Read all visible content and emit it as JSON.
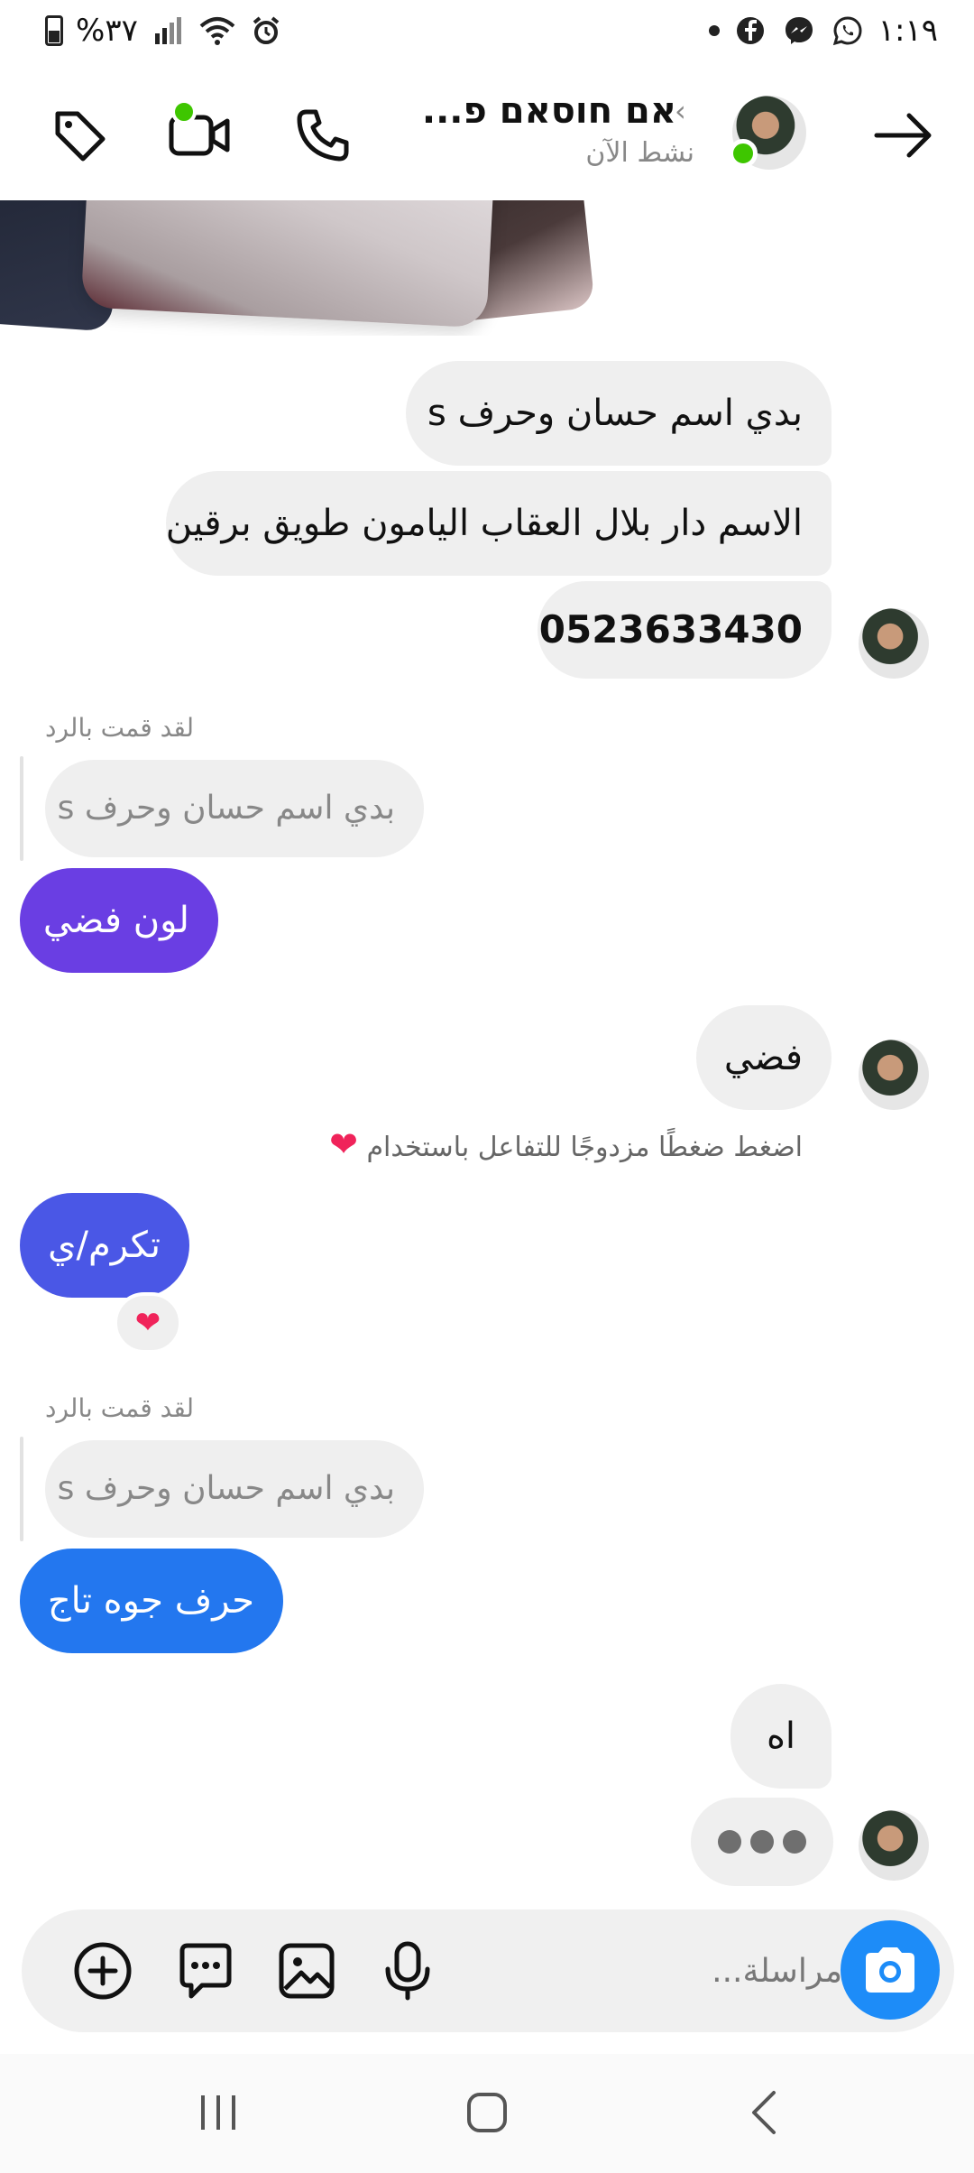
{
  "status_bar": {
    "time": "١:١٩",
    "battery": "%٣٧",
    "icons": [
      "whatsapp-icon",
      "messenger-icon",
      "facebook-icon",
      "notification-dot-icon",
      "alarm-icon",
      "wifi-icon",
      "signal-icon",
      "battery-icon"
    ]
  },
  "header": {
    "contact_name": "אם חוסאם פ...",
    "status": "نشط الآن",
    "back_icon": "arrow-right-icon",
    "icons": [
      "phone-icon",
      "video-icon",
      "tag-icon"
    ]
  },
  "colors": {
    "purple": "#6a3ee3",
    "indigo": "#4a57e6",
    "blue": "#2377ef",
    "camera_blue": "#1d8cf8",
    "online_green": "#3ec600",
    "heart": "#f0235a"
  },
  "messages": {
    "m1": "بدي اسم  حسان وحرف s",
    "m2": "الاسم دار بلال العقاب اليامون طويق برقين",
    "m3": "0523633430",
    "reply_label_1": "لقد قمت بالرد",
    "quote_1": "بدي اسم  حسان وحرف s",
    "out_1": "لون فضي",
    "m4": "فضي",
    "hint": "اضغط ضغطًا مزدوجًا للتفاعل باستخدام",
    "out_2": "تكرم/ي",
    "reaction": "❤",
    "reply_label_2": "لقد قمت بالرد",
    "quote_2": "بدي اسم  حسان وحرف s",
    "out_3": "حرف جوه تاج",
    "m5": "اه"
  },
  "composer": {
    "placeholder": "مراسلة...",
    "icons": [
      "add-icon",
      "sticker-icon",
      "gallery-icon",
      "microphone-icon",
      "camera-icon"
    ]
  },
  "navbar": {
    "icons": [
      "recents-icon",
      "home-icon",
      "back-icon"
    ]
  }
}
